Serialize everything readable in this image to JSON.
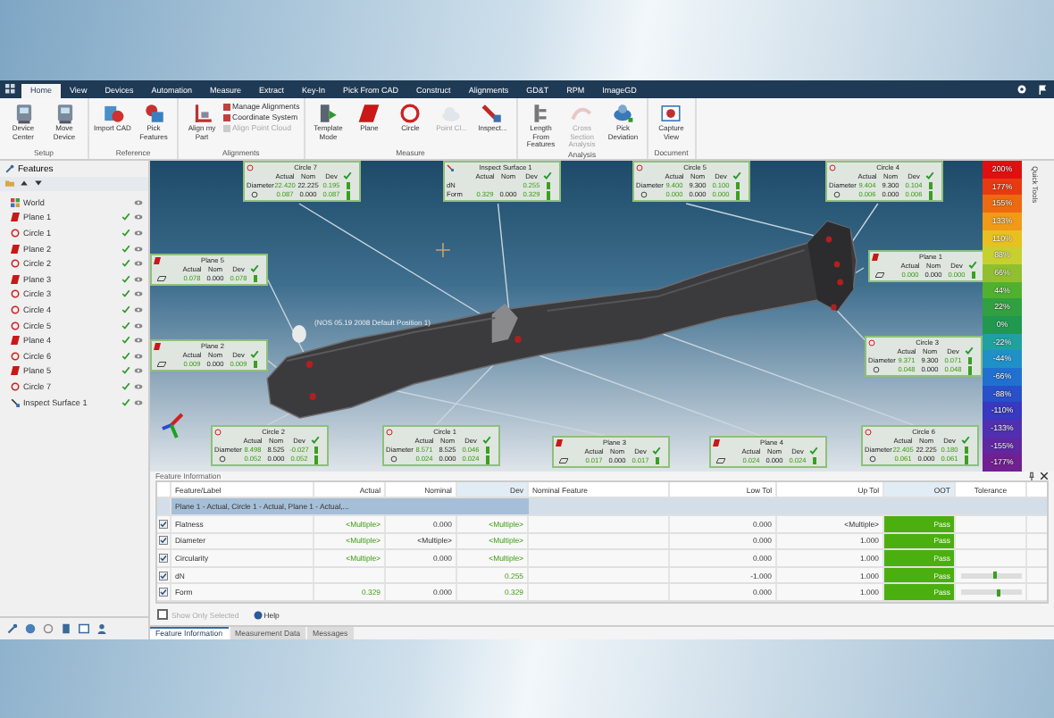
{
  "menu_tabs": [
    {
      "label": "Home",
      "selected": true
    },
    {
      "label": "View",
      "selected": false
    },
    {
      "label": "Devices",
      "selected": false
    },
    {
      "label": "Automation",
      "selected": false
    },
    {
      "label": "Measure",
      "selected": false
    },
    {
      "label": "Extract",
      "selected": false
    },
    {
      "label": "Key-In",
      "selected": false
    },
    {
      "label": "Pick From CAD",
      "selected": false
    },
    {
      "label": "Construct",
      "selected": false
    },
    {
      "label": "Alignments",
      "selected": false
    },
    {
      "label": "GD&T",
      "selected": false
    },
    {
      "label": "RPM",
      "selected": false
    },
    {
      "label": "ImageGD",
      "selected": false
    }
  ],
  "ribbon": [
    {
      "label": "Setup",
      "items": [
        {
          "label": "Device Center",
          "kind": "device",
          "disabled": false
        },
        {
          "label": "Move Device",
          "kind": "device",
          "disabled": false
        }
      ]
    },
    {
      "label": "Reference",
      "items": [
        {
          "label": "Import CAD",
          "kind": "import",
          "disabled": false
        },
        {
          "label": "Pick Features",
          "kind": "features",
          "disabled": false
        }
      ]
    },
    {
      "label": "Alignments",
      "items": [
        {
          "label": "Align my Part",
          "kind": "align",
          "disabled": false
        }
      ],
      "list": [
        {
          "label": "Manage Alignments",
          "disabled": false
        },
        {
          "label": "Coordinate System",
          "disabled": false
        },
        {
          "label": "Align Point Cloud",
          "disabled": true
        }
      ]
    },
    {
      "label": "Measure",
      "items": [
        {
          "label": "Template Mode",
          "kind": "template",
          "disabled": false
        },
        {
          "label": "Plane",
          "kind": "plane",
          "disabled": false
        },
        {
          "label": "Circle",
          "kind": "circle",
          "disabled": false
        },
        {
          "label": "Point Cl...",
          "kind": "cloud",
          "disabled": true
        },
        {
          "label": "Inspect...",
          "kind": "inspect",
          "disabled": false
        }
      ]
    },
    {
      "label": "Analysis",
      "items": [
        {
          "label": "Length From Features",
          "kind": "length",
          "disabled": false
        },
        {
          "label": "Cross Section Analysis",
          "kind": "section",
          "disabled": true
        },
        {
          "label": "Pick Deviation",
          "kind": "deviation",
          "disabled": false
        }
      ]
    },
    {
      "label": "Document",
      "items": [
        {
          "label": "Capture View",
          "kind": "capture",
          "disabled": false
        }
      ]
    }
  ],
  "features_panel": {
    "title": "Features",
    "items": [
      {
        "label": "World",
        "kind": "world",
        "measured": false
      },
      {
        "label": "Plane 1",
        "kind": "plane",
        "measured": true
      },
      {
        "label": "Circle 1",
        "kind": "circle",
        "measured": true
      },
      {
        "label": "Plane 2",
        "kind": "plane",
        "measured": true
      },
      {
        "label": "Circle 2",
        "kind": "circle",
        "measured": true
      },
      {
        "label": "Plane 3",
        "kind": "plane",
        "measured": true
      },
      {
        "label": "Circle 3",
        "kind": "circle",
        "measured": true
      },
      {
        "label": "Circle 4",
        "kind": "circle",
        "measured": true
      },
      {
        "label": "Circle 5",
        "kind": "circle",
        "measured": true
      },
      {
        "label": "Plane 4",
        "kind": "plane",
        "measured": true
      },
      {
        "label": "Circle 6",
        "kind": "circle",
        "measured": true
      },
      {
        "label": "Plane 5",
        "kind": "plane",
        "measured": true
      },
      {
        "label": "Circle 7",
        "kind": "circle",
        "measured": true
      },
      {
        "label": "Inspect Surface 1",
        "kind": "surface",
        "measured": true
      }
    ]
  },
  "viewport": {
    "position_label": "(NOS 05.19 2008 Default Position 1)",
    "callouts": [
      {
        "title": "Circle 7",
        "kind": "circle",
        "pass": true,
        "columns": [
          "Actual",
          "Nom",
          "Dev"
        ],
        "rows": [
          {
            "label": "Diameter",
            "actual": "22.420",
            "nom": "22.225",
            "dev": "0.195"
          },
          {
            "actual": "0.087",
            "nom": "0.000",
            "dev": "0.087"
          }
        ]
      },
      {
        "title": "Inspect Surface 1",
        "kind": "surface",
        "pass": true,
        "columns": [
          "Actual",
          "Nom",
          "Dev"
        ],
        "rows": [
          {
            "label": "dN",
            "actual": "",
            "nom": "",
            "dev": "0.255"
          },
          {
            "label": "Form",
            "actual": "0.329",
            "nom": "0.000",
            "dev": "0.329"
          }
        ]
      },
      {
        "title": "Circle 5",
        "kind": "circle",
        "pass": true,
        "columns": [
          "Actual",
          "Nom",
          "Dev"
        ],
        "rows": [
          {
            "label": "Diameter",
            "actual": "9.400",
            "nom": "9.300",
            "dev": "0.100"
          },
          {
            "actual": "0.000",
            "nom": "0.000",
            "dev": "0.000"
          }
        ]
      },
      {
        "title": "Circle 4",
        "kind": "circle",
        "pass": true,
        "columns": [
          "Actual",
          "Nom",
          "Dev"
        ],
        "rows": [
          {
            "label": "Diameter",
            "actual": "9.404",
            "nom": "9.300",
            "dev": "0.104"
          },
          {
            "actual": "0.006",
            "nom": "0.000",
            "dev": "0.006"
          }
        ]
      },
      {
        "title": "Plane 5",
        "kind": "plane",
        "pass": true,
        "columns": [
          "Actual",
          "Nom",
          "Dev"
        ],
        "rows": [
          {
            "actual": "0.078",
            "nom": "0.000",
            "dev": "0.078"
          }
        ]
      },
      {
        "title": "Plane 2",
        "kind": "plane",
        "pass": true,
        "columns": [
          "Actual",
          "Nom",
          "Dev"
        ],
        "rows": [
          {
            "actual": "0.009",
            "nom": "0.000",
            "dev": "0.009"
          }
        ]
      },
      {
        "title": "Plane 1",
        "kind": "plane",
        "pass": true,
        "columns": [
          "Actual",
          "Nom",
          "Dev"
        ],
        "rows": [
          {
            "actual": "0.000",
            "nom": "0.000",
            "dev": "0.000"
          }
        ]
      },
      {
        "title": "Circle 3",
        "kind": "circle",
        "pass": true,
        "columns": [
          "Actual",
          "Nom",
          "Dev"
        ],
        "rows": [
          {
            "label": "Diameter",
            "actual": "9.371",
            "nom": "9.300",
            "dev": "0.071"
          },
          {
            "actual": "0.048",
            "nom": "0.000",
            "dev": "0.048"
          }
        ]
      },
      {
        "title": "Circle 2",
        "kind": "circle",
        "pass": true,
        "columns": [
          "Actual",
          "Nom",
          "Dev"
        ],
        "rows": [
          {
            "label": "Diameter",
            "actual": "8.498",
            "nom": "8.525",
            "dev": "-0.027"
          },
          {
            "actual": "0.052",
            "nom": "0.000",
            "dev": "0.052"
          }
        ]
      },
      {
        "title": "Circle 1",
        "kind": "circle",
        "pass": true,
        "columns": [
          "Actual",
          "Nom",
          "Dev"
        ],
        "rows": [
          {
            "label": "Diameter",
            "actual": "8.571",
            "nom": "8.525",
            "dev": "0.046"
          },
          {
            "actual": "0.024",
            "nom": "0.000",
            "dev": "0.024"
          }
        ]
      },
      {
        "title": "Plane 3",
        "kind": "plane",
        "pass": true,
        "columns": [
          "Actual",
          "Nom",
          "Dev"
        ],
        "rows": [
          {
            "actual": "0.017",
            "nom": "0.000",
            "dev": "0.017"
          }
        ]
      },
      {
        "title": "Plane 4",
        "kind": "plane",
        "pass": true,
        "columns": [
          "Actual",
          "Nom",
          "Dev"
        ],
        "rows": [
          {
            "actual": "0.024",
            "nom": "0.000",
            "dev": "0.024"
          }
        ]
      },
      {
        "title": "Circle 6",
        "kind": "circle",
        "pass": true,
        "columns": [
          "Actual",
          "Nom",
          "Dev"
        ],
        "rows": [
          {
            "label": "Diameter",
            "actual": "22.405",
            "nom": "22.225",
            "dev": "0.180"
          },
          {
            "actual": "0.061",
            "nom": "0.000",
            "dev": "0.061"
          }
        ]
      }
    ],
    "color_scale": [
      {
        "label": "200%",
        "color": "#e01010"
      },
      {
        "label": "177%",
        "color": "#e83a10"
      },
      {
        "label": "155%",
        "color": "#ee6a10"
      },
      {
        "label": "133%",
        "color": "#f09a18"
      },
      {
        "label": "110%",
        "color": "#e8c020"
      },
      {
        "label": "88%",
        "color": "#c8d030"
      },
      {
        "label": "66%",
        "color": "#90c030"
      },
      {
        "label": "44%",
        "color": "#50b030"
      },
      {
        "label": "22%",
        "color": "#30a040"
      },
      {
        "label": "0%",
        "color": "#209850"
      },
      {
        "label": "-22%",
        "color": "#20a0a0"
      },
      {
        "label": "-44%",
        "color": "#2090c8"
      },
      {
        "label": "-66%",
        "color": "#2070d0"
      },
      {
        "label": "-88%",
        "color": "#2850c8"
      },
      {
        "label": "-110%",
        "color": "#3838c0"
      },
      {
        "label": "-133%",
        "color": "#5030b0"
      },
      {
        "label": "-155%",
        "color": "#6028a0"
      },
      {
        "label": "-177%",
        "color": "#702090"
      }
    ],
    "side_tab": "Quick Tools"
  },
  "feature_information": {
    "title": "Feature Information",
    "columns": [
      "Feature/Label",
      "Actual",
      "Nominal",
      "Dev",
      "Nominal Feature",
      "Low Tol",
      "Up Tol",
      "OOT",
      "Tolerance"
    ],
    "group_row": "Plane 1 - Actual, Circle 1 - Actual, Plane 1 - Actual,...",
    "rows": [
      {
        "checked": true,
        "label": "Flatness",
        "actual": "<Multiple>",
        "nominal": "0.000",
        "dev": "<Multiple>",
        "low_tol": "0.000",
        "up_tol": "<Multiple>",
        "oot": "Pass"
      },
      {
        "checked": true,
        "label": "Diameter",
        "actual": "<Multiple>",
        "nominal": "<Multiple>",
        "dev": "<Multiple>",
        "low_tol": "0.000",
        "up_tol": "1.000",
        "oot": "Pass"
      },
      {
        "checked": true,
        "label": "Circularity",
        "actual": "<Multiple>",
        "nominal": "0.000",
        "dev": "<Multiple>",
        "low_tol": "0.000",
        "up_tol": "1.000",
        "oot": "Pass"
      },
      {
        "checked": true,
        "label": "dN",
        "actual": "",
        "nominal": "",
        "dev": "0.255",
        "low_tol": "-1.000",
        "up_tol": "1.000",
        "oot": "Pass",
        "level": 0.55
      },
      {
        "checked": true,
        "label": "Form",
        "actual": "0.329",
        "nominal": "0.000",
        "dev": "0.329",
        "low_tol": "0.000",
        "up_tol": "1.000",
        "oot": "Pass",
        "level": 0.6
      }
    ],
    "show_only_selected": {
      "label": "Show Only Selected",
      "checked": false,
      "disabled": true
    },
    "help": "Help"
  },
  "bottom_tabs": [
    {
      "label": "Feature Information",
      "selected": true
    },
    {
      "label": "Measurement Data",
      "selected": false
    },
    {
      "label": "Messages",
      "selected": false
    }
  ]
}
